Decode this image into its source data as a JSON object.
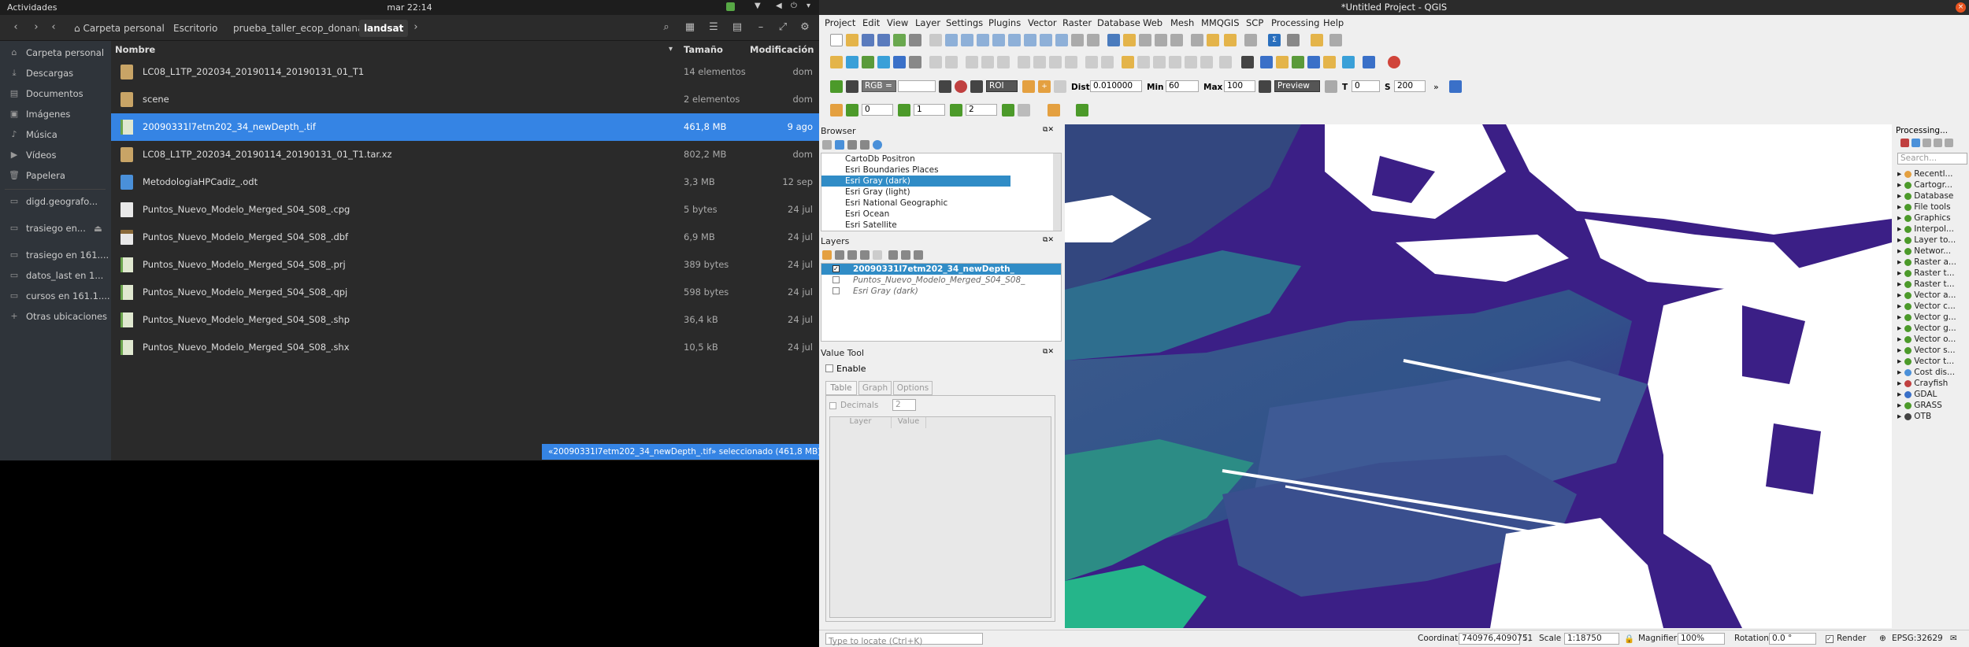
{
  "topbar": {
    "activities": "Actividades",
    "clock": "mar 22:14"
  },
  "files": {
    "breadcrumbs": [
      "Carpeta personal",
      "Escritorio",
      "prueba_taller_ecop_donana",
      "landsat"
    ],
    "columns": {
      "name": "Nombre",
      "size": "Tamaño",
      "modified": "Modificación"
    },
    "sidebar": [
      {
        "label": "Carpeta personal",
        "icon": "home-icon"
      },
      {
        "label": "Descargas",
        "icon": "download-icon"
      },
      {
        "label": "Documentos",
        "icon": "document-icon"
      },
      {
        "label": "Imágenes",
        "icon": "image-icon"
      },
      {
        "label": "Música",
        "icon": "music-icon"
      },
      {
        "label": "Vídeos",
        "icon": "video-icon"
      },
      {
        "label": "Papelera",
        "icon": "trash-icon"
      },
      {
        "label": "digd.geografo...",
        "icon": "network-icon"
      },
      {
        "label": "trasiego en...",
        "icon": "network-icon"
      },
      {
        "label": "trasiego en 161....",
        "icon": "network-icon"
      },
      {
        "label": "datos_last en 1...",
        "icon": "network-icon"
      },
      {
        "label": "cursos en 161.1....",
        "icon": "network-icon"
      },
      {
        "label": "Otras ubicaciones",
        "icon": "plus-icon"
      }
    ],
    "rows": [
      {
        "name": "LC08_L1TP_202034_20190114_20190131_01_T1",
        "size": "14 elementos",
        "date": "dom",
        "type": "folder"
      },
      {
        "name": "scene",
        "size": "2 elementos",
        "date": "dom",
        "type": "folder"
      },
      {
        "name": "20090331l7etm202_34_newDepth_.tif",
        "size": "461,8 MB",
        "date": "9 ago",
        "type": "green"
      },
      {
        "name": "LC08_L1TP_202034_20190114_20190131_01_T1.tar.xz",
        "size": "802,2 MB",
        "date": "dom",
        "type": "folder"
      },
      {
        "name": "MetodologiaHPCadiz_.odt",
        "size": "3,3 MB",
        "date": "12 sep",
        "type": "doc"
      },
      {
        "name": "Puntos_Nuevo_Modelo_Merged_S04_S08_.cpg",
        "size": "5 bytes",
        "date": "24 jul",
        "type": "doc"
      },
      {
        "name": "Puntos_Nuevo_Modelo_Merged_S04_S08_.dbf",
        "size": "6,9 MB",
        "date": "24 jul",
        "type": "doc"
      },
      {
        "name": "Puntos_Nuevo_Modelo_Merged_S04_S08_.prj",
        "size": "389 bytes",
        "date": "24 jul",
        "type": "green"
      },
      {
        "name": "Puntos_Nuevo_Modelo_Merged_S04_S08_.qpj",
        "size": "598 bytes",
        "date": "24 jul",
        "type": "green"
      },
      {
        "name": "Puntos_Nuevo_Modelo_Merged_S04_S08_.shp",
        "size": "36,4 kB",
        "date": "24 jul",
        "type": "green"
      },
      {
        "name": "Puntos_Nuevo_Modelo_Merged_S04_S08_.shx",
        "size": "10,5 kB",
        "date": "24 jul",
        "type": "green"
      }
    ],
    "selected_index": 2,
    "status": "«20090331l7etm202_34_newDepth_.tif» seleccionado (461,8 MB)"
  },
  "qgis": {
    "title": "*Untitled Project - QGIS",
    "menu": [
      "Project",
      "Edit",
      "View",
      "Layer",
      "Settings",
      "Plugins",
      "Vector",
      "Raster",
      "Database",
      "Web",
      "Mesh",
      "MMQGIS",
      "SCP",
      "Processing",
      "Help"
    ],
    "scp": {
      "rgb": "RGB =",
      "roi": "ROI",
      "dist_label": "Dist",
      "dist_value": "0.010000",
      "min_label": "Min",
      "min_value": "60",
      "max_label": "Max",
      "max_value": "100",
      "preview": "Preview",
      "t_label": "T",
      "t_value": "0",
      "s_label": "S",
      "s_value": "200"
    },
    "spinners": [
      "0",
      "1",
      "2"
    ],
    "browser": {
      "title": "Browser",
      "items": [
        "CartoDb Positron",
        "Esri Boundaries Places",
        "Esri Gray (dark)",
        "Esri Gray (light)",
        "Esri National Geographic",
        "Esri Ocean",
        "Esri Satellite"
      ],
      "selected": 2
    },
    "layers": {
      "title": "Layers",
      "items": [
        {
          "name": "20090331l7etm202_34_newDepth_",
          "checked": true
        },
        {
          "name": "Puntos_Nuevo_Modelo_Merged_S04_S08_",
          "checked": false
        },
        {
          "name": "Esri Gray (dark)",
          "checked": false
        }
      ]
    },
    "value_tool": {
      "title": "Value Tool",
      "enable": "Enable",
      "tabs": [
        "Table",
        "Graph",
        "Options"
      ],
      "decimals": "Decimals",
      "decimals_value": "2",
      "col_layer": "Layer",
      "col_value": "Value"
    },
    "processing": {
      "title": "Processing...",
      "search": "Search...",
      "items": [
        "Recentl...",
        "Cartogr...",
        "Database",
        "File tools",
        "Graphics",
        "Interpol...",
        "Layer to...",
        "Networ...",
        "Raster a...",
        "Raster t...",
        "Raster t...",
        "Vector a...",
        "Vector c...",
        "Vector g...",
        "Vector g...",
        "Vector o...",
        "Vector s...",
        "Vector t...",
        "Cost dis...",
        "Crayfish",
        "GDAL",
        "GRASS",
        "OTB"
      ]
    },
    "status": {
      "locate": "Type to locate (Ctrl+K)",
      "coord_label": "Coordinate",
      "coord_value": "740976,4090751",
      "scale_label": "Scale",
      "scale_value": "1:18750",
      "mag_label": "Magnifier",
      "mag_value": "100%",
      "rot_label": "Rotation",
      "rot_value": "0.0 °",
      "render": "Render",
      "crs": "EPSG:32629"
    }
  }
}
